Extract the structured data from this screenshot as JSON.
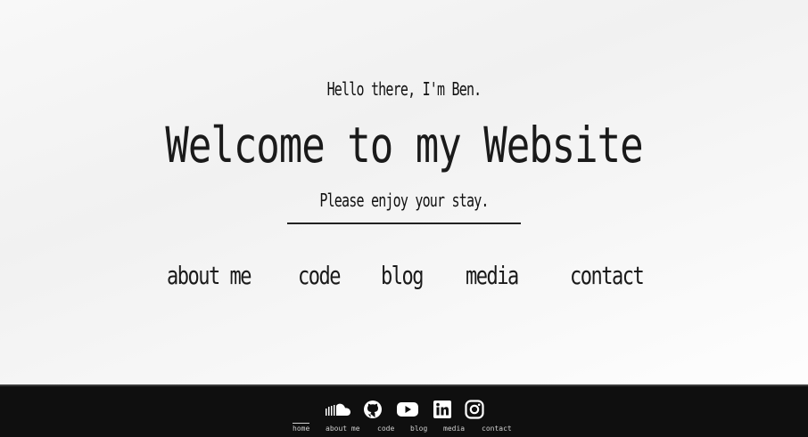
{
  "hero": {
    "greeting": "Hello there, I'm Ben.",
    "title": "Welcome to my Website",
    "tagline": "Please enjoy your stay."
  },
  "nav": {
    "items": [
      {
        "label": "about me"
      },
      {
        "label": "code"
      },
      {
        "label": "blog"
      },
      {
        "label": "media"
      },
      {
        "label": "contact"
      }
    ]
  },
  "footer": {
    "social_icons": [
      "soundcloud-icon",
      "github-icon",
      "youtube-icon",
      "linkedin-icon",
      "instagram-icon"
    ],
    "links": [
      {
        "label": "home",
        "active": true
      },
      {
        "label": "about me"
      },
      {
        "label": "code"
      },
      {
        "label": "blog"
      },
      {
        "label": "media"
      },
      {
        "label": "contact"
      }
    ]
  },
  "colors": {
    "text": "#111111",
    "footer_bg": "#0f0f0f",
    "footer_text": "#cfcfcf"
  }
}
